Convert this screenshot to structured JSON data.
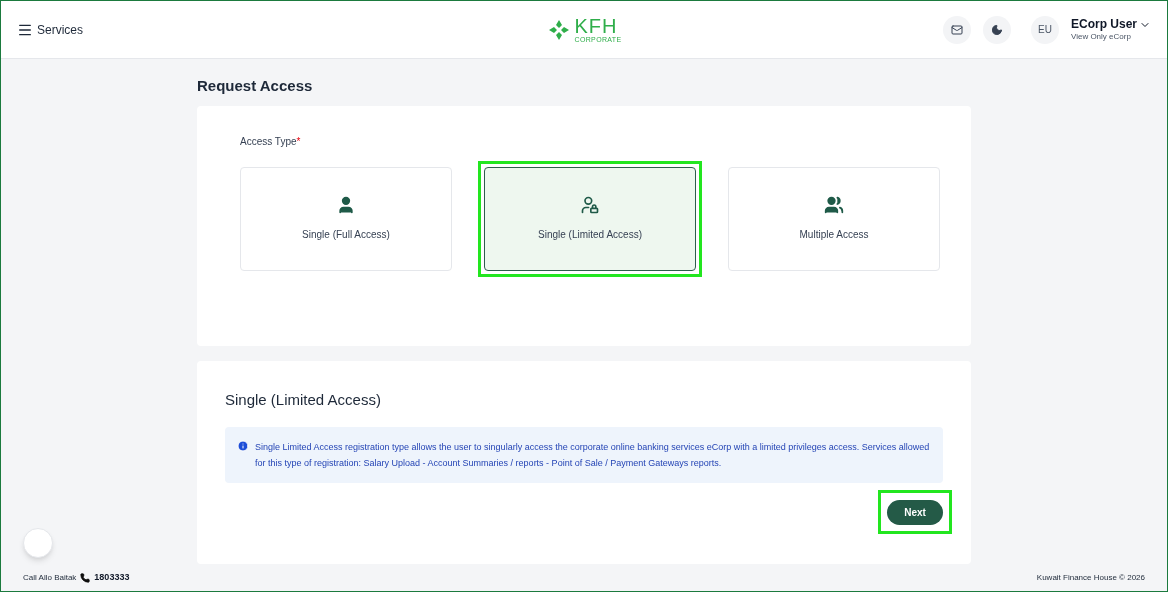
{
  "header": {
    "menu_label": "Services",
    "logo_text": "KFH",
    "logo_subtext": "CORPORATE",
    "avatar": "EU",
    "user_name": "ECorp User",
    "user_role": "View Only eCorp"
  },
  "page_title": "Request Access",
  "access_type": {
    "label": "Access Type",
    "required_mark": "*",
    "options": [
      {
        "kind": "single",
        "label": "Single (Full Access)",
        "selected": false,
        "highlighted": false
      },
      {
        "kind": "limited",
        "label": "Single (Limited Access)",
        "selected": true,
        "highlighted": true
      },
      {
        "kind": "multiple",
        "label": "Multiple Access",
        "selected": false,
        "highlighted": false
      }
    ]
  },
  "details": {
    "title": "Single (Limited Access)",
    "info": "Single Limited Access registration type allows the user to singularly access the corporate online banking services eCorp with a limited privileges access. Services allowed for this type of registration: Salary Upload - Account Summaries / reports - Point of Sale / Payment Gateways reports.",
    "next_button": {
      "label": "Next",
      "highlighted": true
    }
  },
  "footer": {
    "call_label": "Call Allo Baitak",
    "phone": "1803333",
    "copyright": "Kuwait Finance House © 2026"
  }
}
